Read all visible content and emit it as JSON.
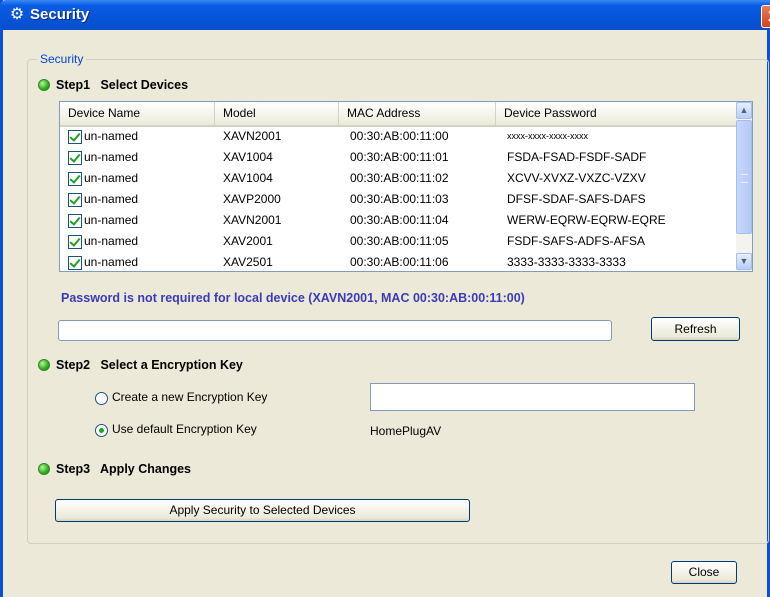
{
  "window": {
    "title": "Security",
    "title_icon": "gear-icon",
    "close_glyph": "X"
  },
  "group": {
    "legend": "Security"
  },
  "step1": {
    "label": "Step1",
    "title": "Select Devices",
    "columns": [
      "Device Name",
      "Model",
      "MAC Address",
      "Device Password"
    ],
    "devices": [
      {
        "checked": true,
        "name": "un-named",
        "model": "XAVN2001",
        "mac": "00:30:AB:00:11:00",
        "password": "xxxx-xxxx-xxxx-xxxx"
      },
      {
        "checked": true,
        "name": "un-named",
        "model": "XAV1004",
        "mac": "00:30:AB:00:11:01",
        "password": "FSDA-FSAD-FSDF-SADF"
      },
      {
        "checked": true,
        "name": "un-named",
        "model": "XAV1004",
        "mac": "00:30:AB:00:11:02",
        "password": "XCVV-XVXZ-VXZC-VZXV"
      },
      {
        "checked": true,
        "name": "un-named",
        "model": "XAVP2000",
        "mac": "00:30:AB:00:11:03",
        "password": "DFSF-SDAF-SAFS-DAFS"
      },
      {
        "checked": true,
        "name": "un-named",
        "model": "XAVN2001",
        "mac": "00:30:AB:00:11:04",
        "password": "WERW-EQRW-EQRW-EQRE"
      },
      {
        "checked": true,
        "name": "un-named",
        "model": "XAV2001",
        "mac": "00:30:AB:00:11:05",
        "password": "FSDF-SAFS-ADFS-AFSA"
      },
      {
        "checked": true,
        "name": "un-named",
        "model": "XAV2501",
        "mac": "00:30:AB:00:11:06",
        "password": "3333-3333-3333-3333"
      }
    ],
    "note": "Password is not required for local device (XAVN2001, MAC 00:30:AB:00:11:00)",
    "refresh_label": "Refresh"
  },
  "step2": {
    "label": "Step2",
    "title": "Select a Encryption Key",
    "option_new": "Create a new Encryption Key",
    "option_default": "Use default Encryption Key",
    "selected": "default",
    "new_key_value": "",
    "default_key": "HomePlugAV"
  },
  "step3": {
    "label": "Step3",
    "title": "Apply Changes",
    "apply_label": "Apply Security to Selected Devices"
  },
  "footer": {
    "close_label": "Close"
  },
  "colors": {
    "title_bar": "#0654d8",
    "legend": "#0046d5",
    "note": "#3b3bb8",
    "status_dot": "#2fae1c"
  }
}
